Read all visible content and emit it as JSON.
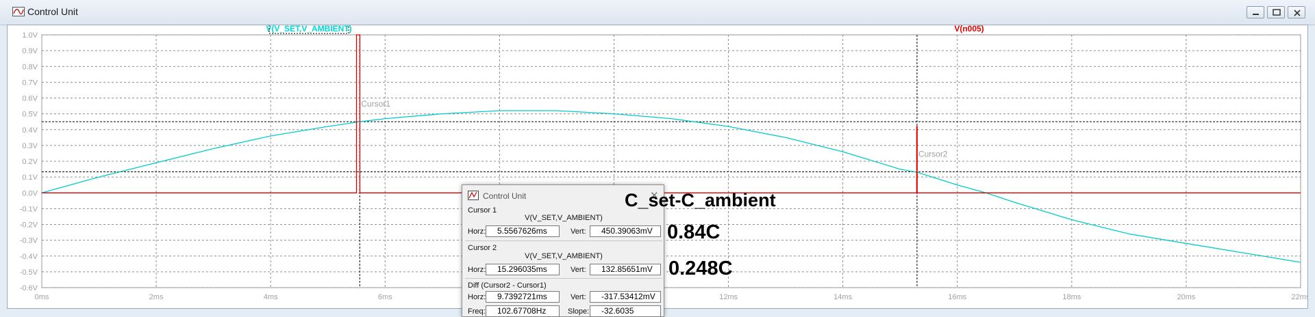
{
  "window": {
    "title": "Control Unit"
  },
  "plot": {
    "trace_labels": [
      {
        "text": "V(V_SET,V_AMBIENT)",
        "color": "#00d8d8"
      },
      {
        "text": "V(n005)",
        "color": "#e00000"
      }
    ],
    "cursor_labels": [
      "Cursor1",
      "Cursor2"
    ]
  },
  "chart_data": {
    "type": "line",
    "xlabel": "",
    "ylabel": "",
    "xlim": [
      0,
      22
    ],
    "ylim": [
      -0.6,
      1.0
    ],
    "x_unit": "ms",
    "xticks": [
      "0ms",
      "2ms",
      "4ms",
      "6ms",
      "8ms",
      "10ms",
      "12ms",
      "14ms",
      "16ms",
      "18ms",
      "20ms",
      "22ms"
    ],
    "yticks": [
      "1.0V",
      "0.9V",
      "0.8V",
      "0.7V",
      "0.6V",
      "0.5V",
      "0.4V",
      "0.3V",
      "0.2V",
      "0.1V",
      "0.0V",
      "-0.1V",
      "-0.2V",
      "-0.3V",
      "-0.4V",
      "-0.5V",
      "-0.6V"
    ],
    "grid": true,
    "series": [
      {
        "name": "V(V_SET,V_AMBIENT)",
        "color": "#00cccc",
        "x": [
          0,
          1,
          2,
          3,
          4,
          5,
          5.56,
          6,
          7,
          8,
          9,
          10,
          11,
          12,
          13,
          14,
          15,
          15.3,
          16,
          16.5,
          17,
          18,
          19,
          20,
          21,
          22
        ],
        "y": [
          0,
          0.1,
          0.19,
          0.28,
          0.36,
          0.42,
          0.45,
          0.47,
          0.5,
          0.52,
          0.52,
          0.5,
          0.47,
          0.42,
          0.35,
          0.26,
          0.15,
          0.13,
          0.05,
          0.0,
          -0.06,
          -0.17,
          -0.26,
          -0.32,
          -0.38,
          -0.44
        ]
      },
      {
        "name": "V(n005)",
        "color": "#e00000",
        "x": [
          0,
          5.5,
          5.5,
          5.56,
          5.56,
          15.29,
          15.29,
          15.3,
          15.3,
          22
        ],
        "y": [
          0,
          0,
          1.0,
          1.0,
          0,
          0,
          0.42,
          0.42,
          0,
          0
        ]
      }
    ],
    "cursors": [
      {
        "label": "Cursor1",
        "x": 5.5567626,
        "y": 0.45039063
      },
      {
        "label": "Cursor2",
        "x": 15.296035,
        "y": 0.13285651
      }
    ]
  },
  "dialog": {
    "title": "Control Unit",
    "close_glyph": "✕",
    "cursor1": {
      "title": "Cursor 1",
      "signal": "V(V_SET,V_AMBIENT)",
      "horz_label": "Horz:",
      "horz": "5.5567626ms",
      "vert_label": "Vert:",
      "vert": "450.39063mV"
    },
    "cursor2": {
      "title": "Cursor 2",
      "signal": "V(V_SET,V_AMBIENT)",
      "horz_label": "Horz:",
      "horz": "15.296035ms",
      "vert_label": "Vert:",
      "vert": "132.85651mV"
    },
    "diff": {
      "title": "Diff (Cursor2 - Cursor1)",
      "horz_label": "Horz:",
      "horz": "9.7392721ms",
      "vert_label": "Vert:",
      "vert": "-317.53412mV",
      "freq_label": "Freq:",
      "freq": "102.67708Hz",
      "slope_label": "Slope:",
      "slope": "-32.6035"
    }
  },
  "annotations": {
    "title": "C_set-C_ambient",
    "value1": "0.84C",
    "value2": "0.248C"
  }
}
